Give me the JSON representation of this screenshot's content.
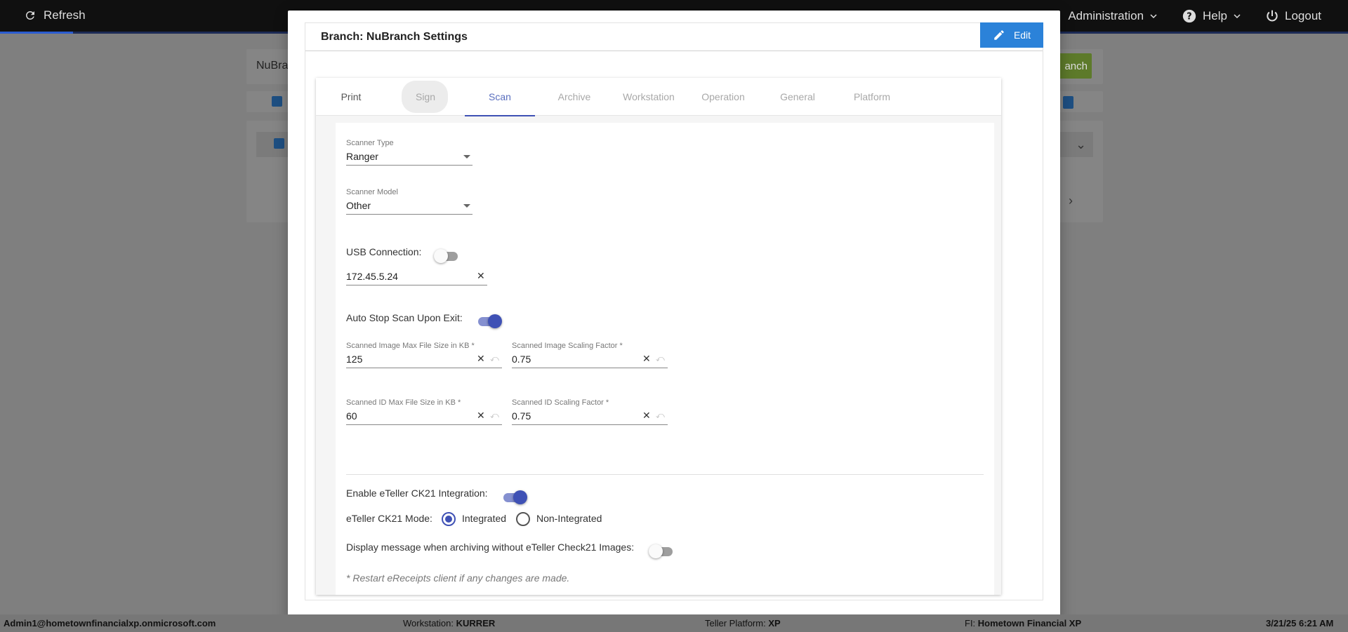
{
  "topbar": {
    "refresh_label": "Refresh",
    "nav": [
      {
        "label": "Administration",
        "icon": "chevron-down-icon"
      },
      {
        "label": "Help",
        "icon": "help-circle-icon"
      },
      {
        "label": "Logout",
        "icon": "power-icon"
      }
    ]
  },
  "background": {
    "search_value": "NuBra",
    "add_button_label": "anch"
  },
  "modal": {
    "title": "Branch: NuBranch Settings",
    "edit_label": "Edit",
    "tabs": [
      "Print",
      "Sign",
      "Scan",
      "Archive",
      "Workstation",
      "Operation",
      "General",
      "Platform"
    ],
    "active_tab": "Scan",
    "scanner_type": {
      "label": "Scanner Type",
      "value": "Ranger"
    },
    "scanner_model": {
      "label": "Scanner Model",
      "value": "Other"
    },
    "usb_connection": {
      "label": "USB Connection:",
      "enabled": false
    },
    "ip_address": {
      "value": "172.45.5.24"
    },
    "auto_stop": {
      "label": "Auto Stop Scan Upon Exit:",
      "enabled": true
    },
    "image_max_size": {
      "label": "Scanned Image Max File Size in KB *",
      "value": "125"
    },
    "image_scaling": {
      "label": "Scanned Image Scaling Factor *",
      "value": "0.75"
    },
    "id_max_size": {
      "label": "Scanned ID Max File Size in KB *",
      "value": "60"
    },
    "id_scaling": {
      "label": "Scanned ID Scaling Factor *",
      "value": "0.75"
    },
    "ck21_integration": {
      "label": "Enable eTeller CK21 Integration:",
      "enabled": true
    },
    "ck21_mode": {
      "label": "eTeller CK21 Mode:",
      "options": [
        "Integrated",
        "Non-Integrated"
      ],
      "selected": "Integrated"
    },
    "archive_message": {
      "label": "Display message when archiving without eTeller Check21 Images:",
      "enabled": false
    },
    "note": "* Restart eReceipts client if any changes are made."
  },
  "statusbar": {
    "user": "Admin1@hometownfinancialxp.onmicrosoft.com",
    "workstation_label": "Workstation:",
    "workstation_value": "KURRER",
    "platform_label": "Teller Platform:",
    "platform_value": "XP",
    "fi_label": "FI:",
    "fi_value": "Hometown Financial XP",
    "datetime": "3/21/25 6:21 AM"
  },
  "colors": {
    "accent": "#3f51b5",
    "edit_button": "#2b82d9",
    "topbar": "#101010"
  }
}
